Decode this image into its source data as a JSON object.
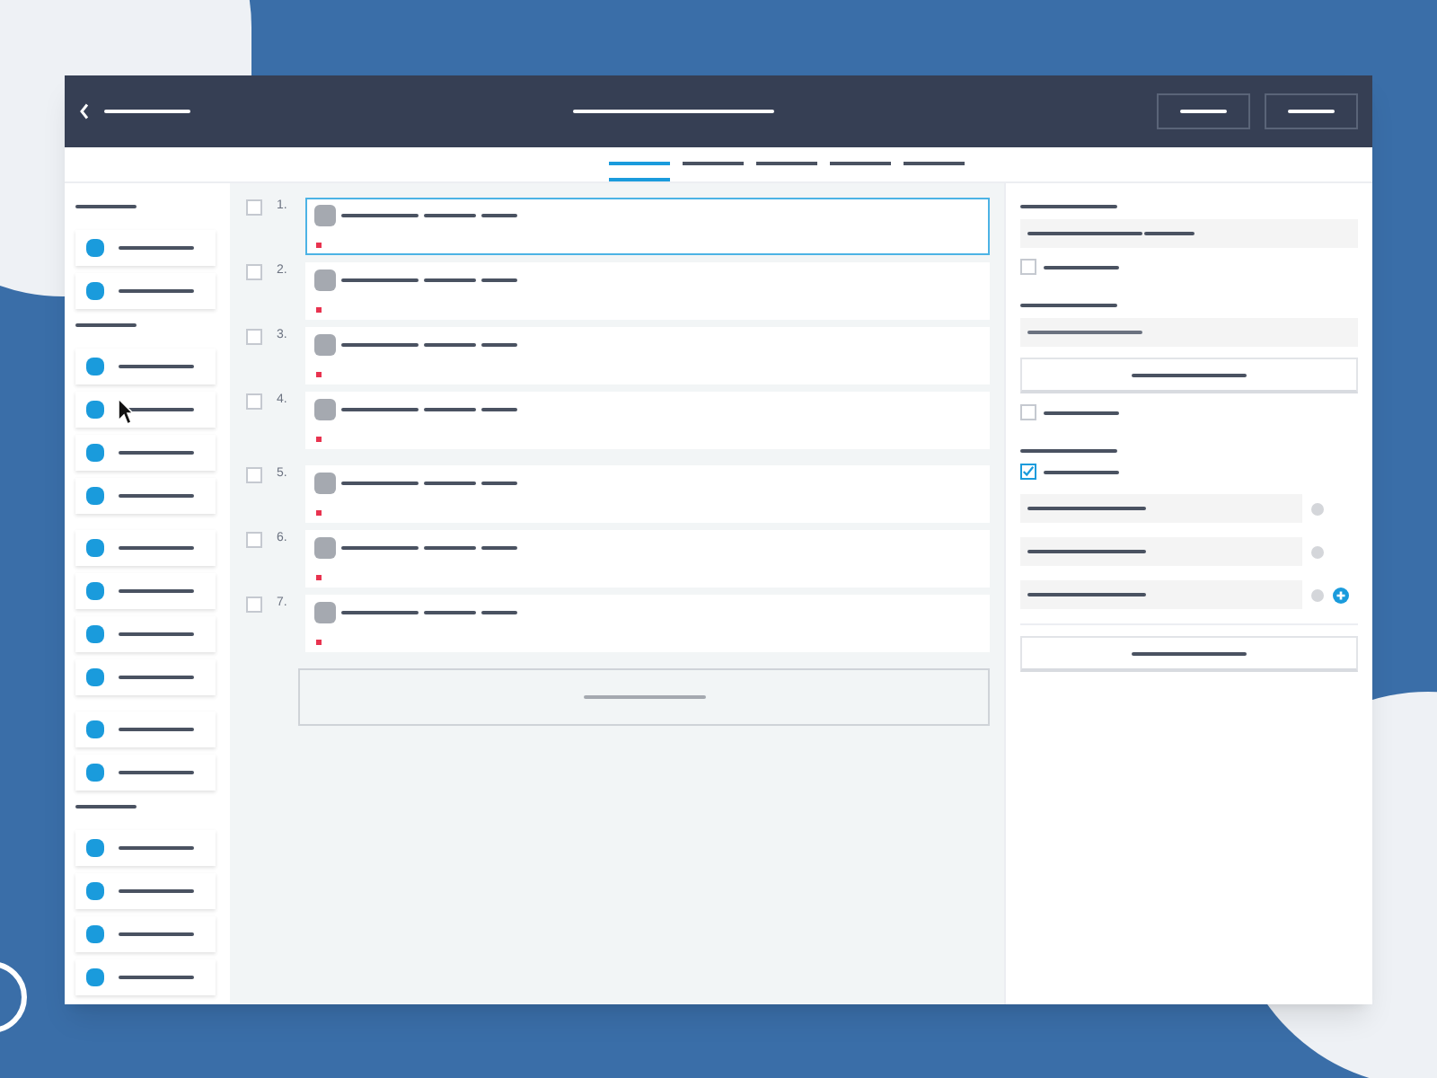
{
  "tabs": [
    {
      "selected": true
    },
    {
      "selected": false
    },
    {
      "selected": false
    },
    {
      "selected": false
    },
    {
      "selected": false
    }
  ],
  "sidebar": {
    "groups": [
      {
        "items": [
          {
            "selected": false
          },
          {
            "selected": false
          }
        ]
      },
      {
        "items": [
          {
            "selected": false
          },
          {
            "selected": false
          },
          {
            "selected": false
          },
          {
            "selected": false
          },
          {
            "selected": false
          },
          {
            "selected": false
          },
          {
            "selected": false
          },
          {
            "selected": false
          },
          {
            "selected": false
          },
          {
            "selected": false
          }
        ]
      },
      {
        "items": [
          {
            "selected": false
          },
          {
            "selected": false
          },
          {
            "selected": false
          },
          {
            "selected": false
          }
        ]
      }
    ]
  },
  "rows": [
    {
      "number": "1.",
      "checked": false,
      "selected": true
    },
    {
      "number": "2.",
      "checked": false,
      "selected": false
    },
    {
      "number": "3.",
      "checked": false,
      "selected": false
    },
    {
      "number": "4.",
      "checked": false,
      "selected": false
    },
    {
      "number": "5.",
      "checked": false,
      "selected": false
    },
    {
      "number": "6.",
      "checked": false,
      "selected": false
    },
    {
      "number": "7.",
      "checked": false,
      "selected": false
    }
  ],
  "panel": {
    "checkboxes": [
      {
        "checked": false
      },
      {
        "checked": false
      },
      {
        "checked": true
      }
    ],
    "fields": [
      {
        "kind": "plain"
      },
      {
        "kind": "plain"
      },
      {
        "kind": "addable"
      }
    ]
  }
}
